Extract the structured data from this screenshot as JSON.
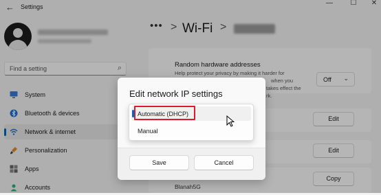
{
  "titlebar": {
    "title": "Settings",
    "back": "←",
    "minimize": "—",
    "maximize": "☐",
    "close": "✕"
  },
  "sidebar": {
    "search_placeholder": "Find a setting",
    "items": [
      {
        "label": "System",
        "icon": "monitor-icon",
        "active": false
      },
      {
        "label": "Bluetooth & devices",
        "icon": "bluetooth-icon",
        "active": false
      },
      {
        "label": "Network & internet",
        "icon": "wifi-icon",
        "active": true
      },
      {
        "label": "Personalization",
        "icon": "paint-brush-icon",
        "active": false
      },
      {
        "label": "Apps",
        "icon": "apps-grid-icon",
        "active": false
      },
      {
        "label": "Accounts",
        "icon": "person-icon",
        "active": false
      }
    ]
  },
  "breadcrumb": {
    "dots": "•••",
    "separator": ">",
    "current": "Wi-Fi"
  },
  "main": {
    "random_hw_title": "Random hardware addresses",
    "random_hw_desc_1": "Help protect your privacy by making it harder for",
    "random_hw_desc_2": "when you",
    "random_hw_desc_3": "takes effect the",
    "random_hw_desc_4": "rk.",
    "off_value": "Off",
    "edit_label_1": "Edit",
    "edit_label_2": "Edit",
    "copy_label": "Copy",
    "network_name": "Blanah5G"
  },
  "dialog": {
    "title": "Edit network IP settings",
    "options": [
      "Automatic (DHCP)",
      "Manual"
    ],
    "selected": "Automatic (DHCP)",
    "save_label": "Save",
    "cancel_label": "Cancel"
  },
  "colors": {
    "accent": "#0067c0",
    "highlight_box": "#e0182d"
  }
}
